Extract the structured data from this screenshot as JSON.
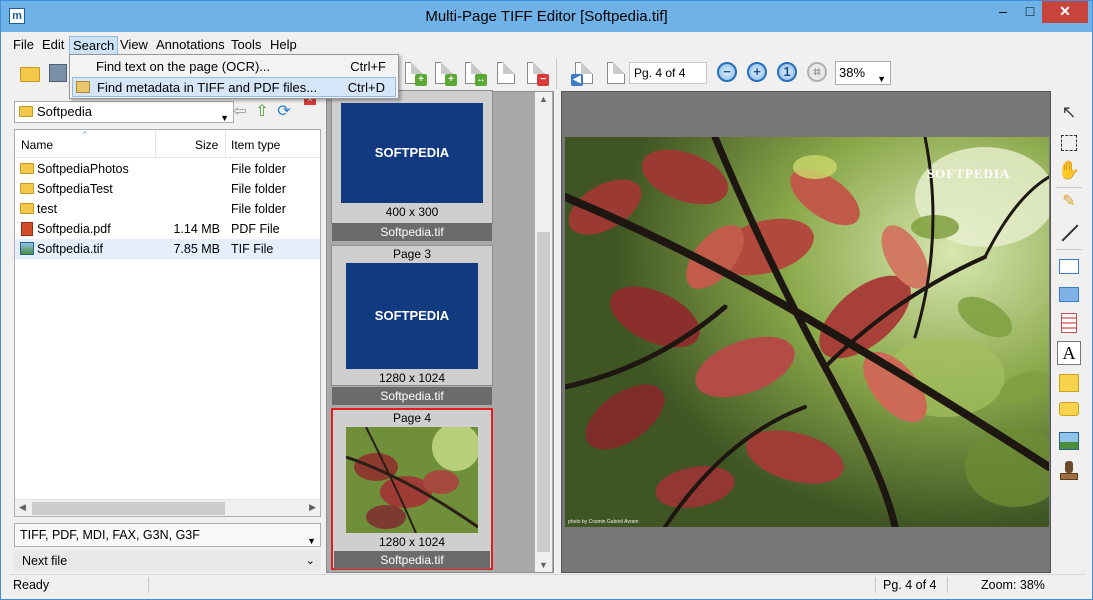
{
  "window": {
    "title": "Multi-Page TIFF Editor [Softpedia.tif]",
    "minimize": "–",
    "maximize": "□",
    "close": "✕"
  },
  "menu": {
    "items": [
      "File",
      "Edit",
      "Search",
      "View",
      "Annotations",
      "Tools",
      "Help"
    ],
    "active": "Search"
  },
  "search_menu": [
    {
      "label": "Find text on the page (OCR)...",
      "shortcut": "Ctrl+F"
    },
    {
      "label": "Find metadata in TIFF and PDF files...",
      "shortcut": "Ctrl+D"
    }
  ],
  "toolbar": {
    "page_indicator": "Pg. 4 of 4",
    "zoom": "38%"
  },
  "browser": {
    "folder": "Softpedia",
    "columns": [
      "Name",
      "Size",
      "Item type"
    ],
    "files": [
      {
        "name": "SoftpediaPhotos",
        "size": "",
        "type": "File folder",
        "icon": "folder-icon"
      },
      {
        "name": "SoftpediaTest",
        "size": "",
        "type": "File folder",
        "icon": "folder-icon"
      },
      {
        "name": "test",
        "size": "",
        "type": "File folder",
        "icon": "folder-icon"
      },
      {
        "name": "Softpedia.pdf",
        "size": "1.14 MB",
        "type": "PDF File",
        "icon": "pdf-icon"
      },
      {
        "name": "Softpedia.tif",
        "size": "7.85 MB",
        "type": "TIF File",
        "icon": "tif-icon"
      }
    ],
    "filter": "TIFF, PDF, MDI, FAX, G3N, G3F",
    "next_file": "Next file"
  },
  "thumbnails": [
    {
      "page": "",
      "dims": "400 x 300",
      "file": "Softpedia.tif",
      "logo": "SOFTPEDIA"
    },
    {
      "page": "Page 3",
      "dims": "1280 x 1024",
      "file": "Softpedia.tif",
      "logo": "SOFTPEDIA"
    },
    {
      "page": "Page 4",
      "dims": "1280 x 1024",
      "file": "Softpedia.tif"
    }
  ],
  "viewer": {
    "watermark": "SOFTPEDIA",
    "credit": "photo by Cosmin Gabriel Avram"
  },
  "status": {
    "left": "Ready",
    "page": "Pg. 4 of 4",
    "zoom": "Zoom: 38%"
  },
  "colors": {
    "titlebar": "#6fb2e8",
    "close": "#c7453d",
    "thumb_selected": "#e41f1f",
    "logo_bg": "#123a80"
  }
}
